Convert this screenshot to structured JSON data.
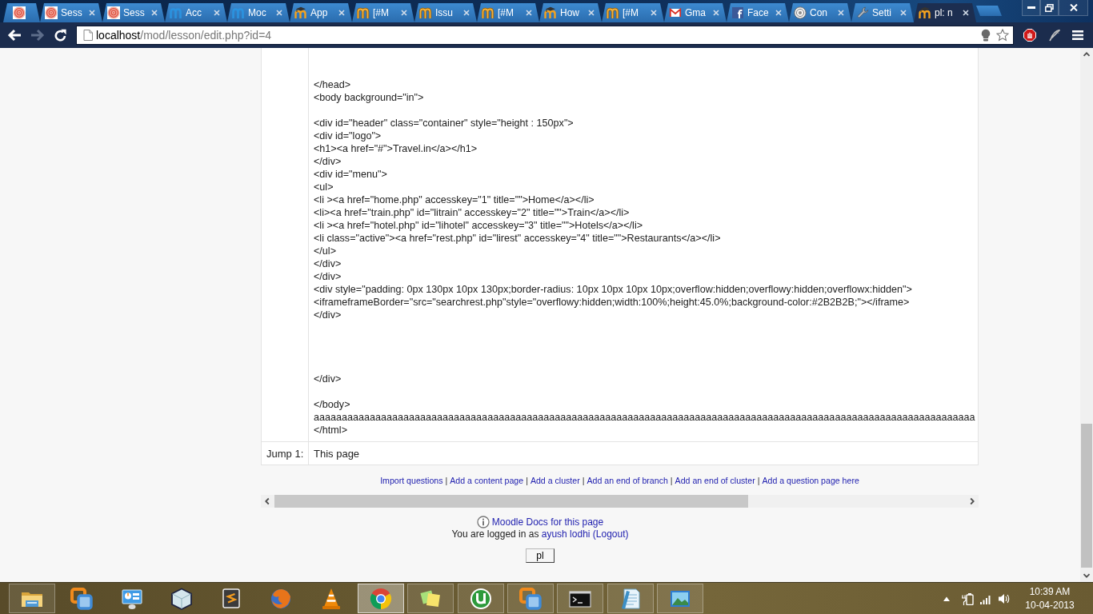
{
  "browser": {
    "tabs": [
      {
        "pinned": true,
        "selected": false
      },
      {
        "label": "Sess",
        "pinned": false,
        "selected": false
      },
      {
        "label": "Sess",
        "pinned": false,
        "selected": false
      },
      {
        "label": "Acc",
        "pinned": false,
        "selected": false
      },
      {
        "label": "Moc",
        "pinned": false,
        "selected": false
      },
      {
        "label": "App",
        "pinned": false,
        "selected": false
      },
      {
        "label": "[#M",
        "pinned": false,
        "selected": false
      },
      {
        "label": "Issu",
        "pinned": false,
        "selected": false
      },
      {
        "label": "[#M",
        "pinned": false,
        "selected": false
      },
      {
        "label": "How",
        "pinned": false,
        "selected": false
      },
      {
        "label": "[#M",
        "pinned": false,
        "selected": false
      },
      {
        "label": "Gma",
        "pinned": false,
        "selected": false
      },
      {
        "label": "Face",
        "pinned": false,
        "selected": false
      },
      {
        "label": "Con",
        "pinned": false,
        "selected": false
      },
      {
        "label": "Setti",
        "pinned": false,
        "selected": false
      },
      {
        "label": "pl: n",
        "pinned": false,
        "selected": true
      }
    ],
    "nav_buttons": [
      {
        "kind": "back",
        "disabled": false
      },
      {
        "kind": "forward",
        "disabled": true
      },
      {
        "kind": "reload",
        "disabled": false
      }
    ],
    "address_bar": {
      "host": "localhost",
      "path": "/mod/lesson/edit.php?id=4"
    }
  },
  "page": {
    "lesson_table": {
      "content": "</head>\n<body background=\"in\">\n\n<div id=\"header\" class=\"container\" style=\"height : 150px\">\n<div id=\"logo\">\n<h1><a href=\"#\">Travel.in</a></h1>\n</div>\n<div id=\"menu\">\n<ul>\n<li ><a href=\"home.php\" accesskey=\"1\" title=\"\">Home</a></li>\n<li><a href=\"train.php\" id=\"litrain\" accesskey=\"2\" title=\"\">Train</a></li>\n<li ><a href=\"hotel.php\" id=\"lihotel\" accesskey=\"3\" title=\"\">Hotels</a></li>\n<li class=\"active\"><a href=\"rest.php\" id=\"lirest\" accesskey=\"4\" title=\"\">Restaurants</a></li>\n</ul>\n</div>\n</div>\n<div style=\"padding: 0px 130px 10px 130px;border-radius: 10px 10px 10px 10px;overflow:hidden;overflowy:hidden;overflowx:hidden\">\n<iframeframeBorder=\"src=\"searchrest.php\"style=\"overflowy:hidden;width:100%;height:45.0%;background-color:#2B2B2B;\"></iframe>\n</div>\n\n\n\n\n</div>\n\n</body>\naaaaaaaaaaaaaaaaaaaaaaaaaaaaaaaaaaaaaaaaaaaaaaaaaaaaaaaaaaaaaaaaaaaaaaaaaaaaaaaaaaaaaaaaaaaaaaaaaaaaaaaaaaaaaaaaaaaaaa\n</html>",
      "jumps": [
        {
          "label": "Jump 1:",
          "target": "This page"
        }
      ]
    },
    "action_links": [
      {
        "label": "Import questions"
      },
      {
        "separator": "|",
        "label": "Add a content page"
      },
      {
        "separator": "|",
        "label": "Add a cluster"
      },
      {
        "separator": "|",
        "label": "Add an end of branch"
      },
      {
        "separator": "|",
        "label": "Add an end of cluster"
      },
      {
        "separator": "|",
        "label": "Add a question page here"
      }
    ],
    "footer": {
      "docs_link": "Moodle Docs for this page",
      "login": {
        "text": "You are logged in as",
        "user": "ayush lodhi",
        "logout": "(Logout)"
      },
      "button": "pl"
    }
  },
  "taskbar": {
    "apps": [
      {
        "running": true,
        "active": false
      },
      {
        "running": false,
        "active": false
      },
      {
        "running": false,
        "active": false
      },
      {
        "running": false,
        "active": false
      },
      {
        "running": false,
        "active": false
      },
      {
        "running": false,
        "active": false
      },
      {
        "running": false,
        "active": false
      },
      {
        "running": true,
        "active": true
      },
      {
        "running": true,
        "active": false
      },
      {
        "running": true,
        "active": false
      },
      {
        "running": true,
        "active": false
      },
      {
        "running": true,
        "active": false
      },
      {
        "running": true,
        "active": false
      },
      {
        "running": true,
        "active": false
      }
    ],
    "clock": {
      "time": "10:39 AM",
      "date": "10-04-2013"
    }
  }
}
